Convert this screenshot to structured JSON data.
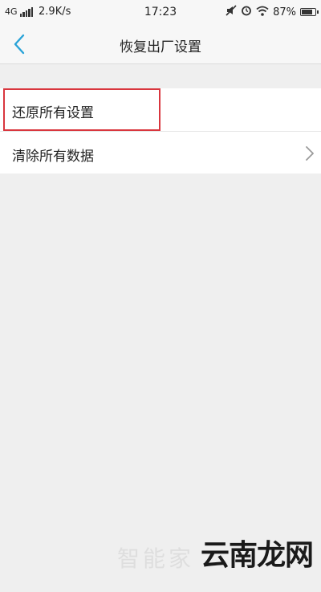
{
  "status_bar": {
    "network": "4G",
    "speed": "2.9K/s",
    "time": "17:23",
    "battery": "87%",
    "battery_level": 0.87,
    "icons": [
      "signal-icon",
      "mute-icon",
      "alarm-icon",
      "wifi-icon",
      "battery-icon"
    ]
  },
  "header": {
    "title": "恢复出厂设置",
    "back_icon": "chevron-left-icon"
  },
  "list": {
    "items": [
      {
        "label": "还原所有设置",
        "highlighted": true
      },
      {
        "label": "清除所有数据",
        "chevron": "chevron-right-icon"
      }
    ]
  },
  "watermark": {
    "faint": "智能家",
    "text": "云南龙网"
  },
  "colors": {
    "accent": "#29a3d8",
    "highlight": "#d9363e",
    "background": "#efefef",
    "card": "#ffffff"
  }
}
